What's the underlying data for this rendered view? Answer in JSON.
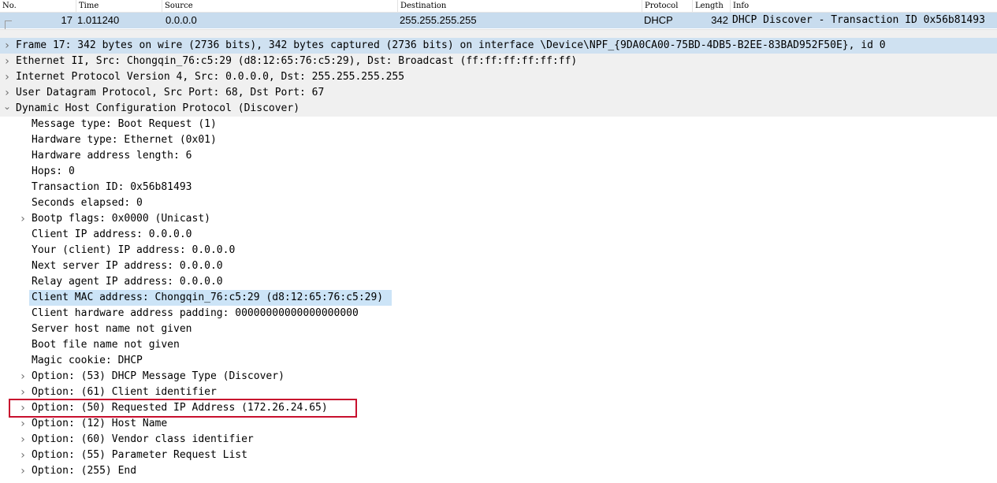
{
  "packet_list": {
    "columns": [
      "No.",
      "Time",
      "Source",
      "Destination",
      "Protocol",
      "Length",
      "Info"
    ],
    "row": {
      "no": "17",
      "time": "1.011240",
      "source": "0.0.0.0",
      "destination": "255.255.255.255",
      "protocol": "DHCP",
      "length": "342",
      "info": "DHCP Discover - Transaction ID 0x56b81493"
    }
  },
  "details": {
    "frame": "Frame 17: 342 bytes on wire (2736 bits), 342 bytes captured (2736 bits) on interface \\Device\\NPF_{9DA0CA00-75BD-4DB5-B2EE-83BAD952F50E}, id 0",
    "ethernet": "Ethernet II, Src: Chongqin_76:c5:29 (d8:12:65:76:c5:29), Dst: Broadcast (ff:ff:ff:ff:ff:ff)",
    "ip": "Internet Protocol Version 4, Src: 0.0.0.0, Dst: 255.255.255.255",
    "udp": "User Datagram Protocol, Src Port: 68, Dst Port: 67",
    "dhcp": "Dynamic Host Configuration Protocol (Discover)",
    "fields": [
      "Message type: Boot Request (1)",
      "Hardware type: Ethernet (0x01)",
      "Hardware address length: 6",
      "Hops: 0",
      "Transaction ID: 0x56b81493",
      "Seconds elapsed: 0",
      "Bootp flags: 0x0000 (Unicast)",
      "Client IP address: 0.0.0.0",
      "Your (client) IP address: 0.0.0.0",
      "Next server IP address: 0.0.0.0",
      "Relay agent IP address: 0.0.0.0",
      "Client MAC address: Chongqin_76:c5:29 (d8:12:65:76:c5:29)",
      "Client hardware address padding: 00000000000000000000",
      "Server host name not given",
      "Boot file name not given",
      "Magic cookie: DHCP",
      "Option: (53) DHCP Message Type (Discover)",
      "Option: (61) Client identifier",
      "Option: (50) Requested IP Address (172.26.24.65)",
      "Option: (12) Host Name",
      "Option: (60) Vendor class identifier",
      "Option: (55) Parameter Request List",
      "Option: (255) End"
    ]
  },
  "icons": {
    "collapsed": "chevron-right-icon",
    "expanded": "chevron-down-icon"
  },
  "colors": {
    "selected_row": "#c8dcee",
    "selected_field": "#cce4f7",
    "highlight_box": "#c8102e",
    "top_level_bg": "#f0f0f0"
  }
}
